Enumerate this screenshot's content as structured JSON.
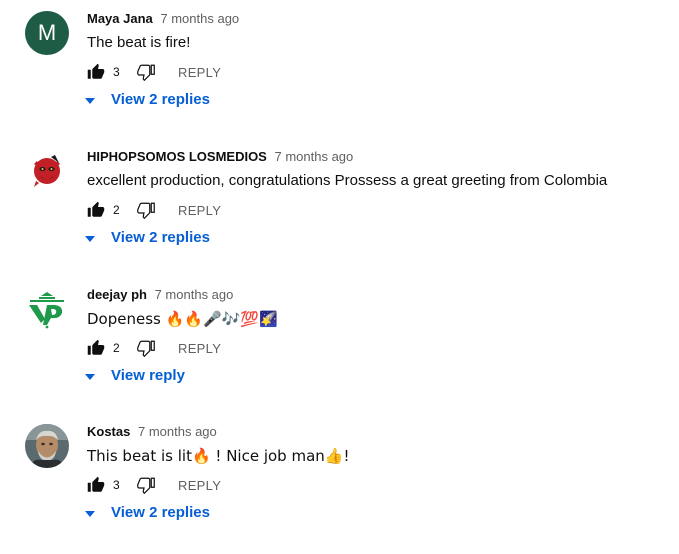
{
  "comments": [
    {
      "author": "Maya Jana",
      "time": "7 months ago",
      "text": "The beat is fire!",
      "likes": "3",
      "reply_label": "REPLY",
      "view_replies": "View 2 replies",
      "avatar_letter": "M",
      "avatar_color": "#1f5c46"
    },
    {
      "author": "HIPHOPSOMOS LOSMEDIOS",
      "time": "7 months ago",
      "text": "excellent production, congratulations Prossess a great greeting from Colombia",
      "likes": "2",
      "reply_label": "REPLY",
      "view_replies": "View 2 replies",
      "avatar_icon": "red-devil-logo-icon"
    },
    {
      "author": "deejay ph",
      "time": "7 months ago",
      "text": "Dopeness 🔥🔥🎤🎶💯🌠",
      "likes": "2",
      "reply_label": "REPLY",
      "view_replies": "View reply",
      "avatar_icon": "green-dj-logo-icon"
    },
    {
      "author": "Kostas",
      "time": "7 months ago",
      "text": "This beat is lit🔥 ! Nice job man👍!",
      "likes": "3",
      "reply_label": "REPLY",
      "view_replies": "View 2 replies",
      "avatar_icon": "profile-photo-icon"
    }
  ],
  "colors": {
    "link_blue": "#065fd4",
    "secondary_text": "#606060",
    "primary_text": "#0f0f0f"
  }
}
